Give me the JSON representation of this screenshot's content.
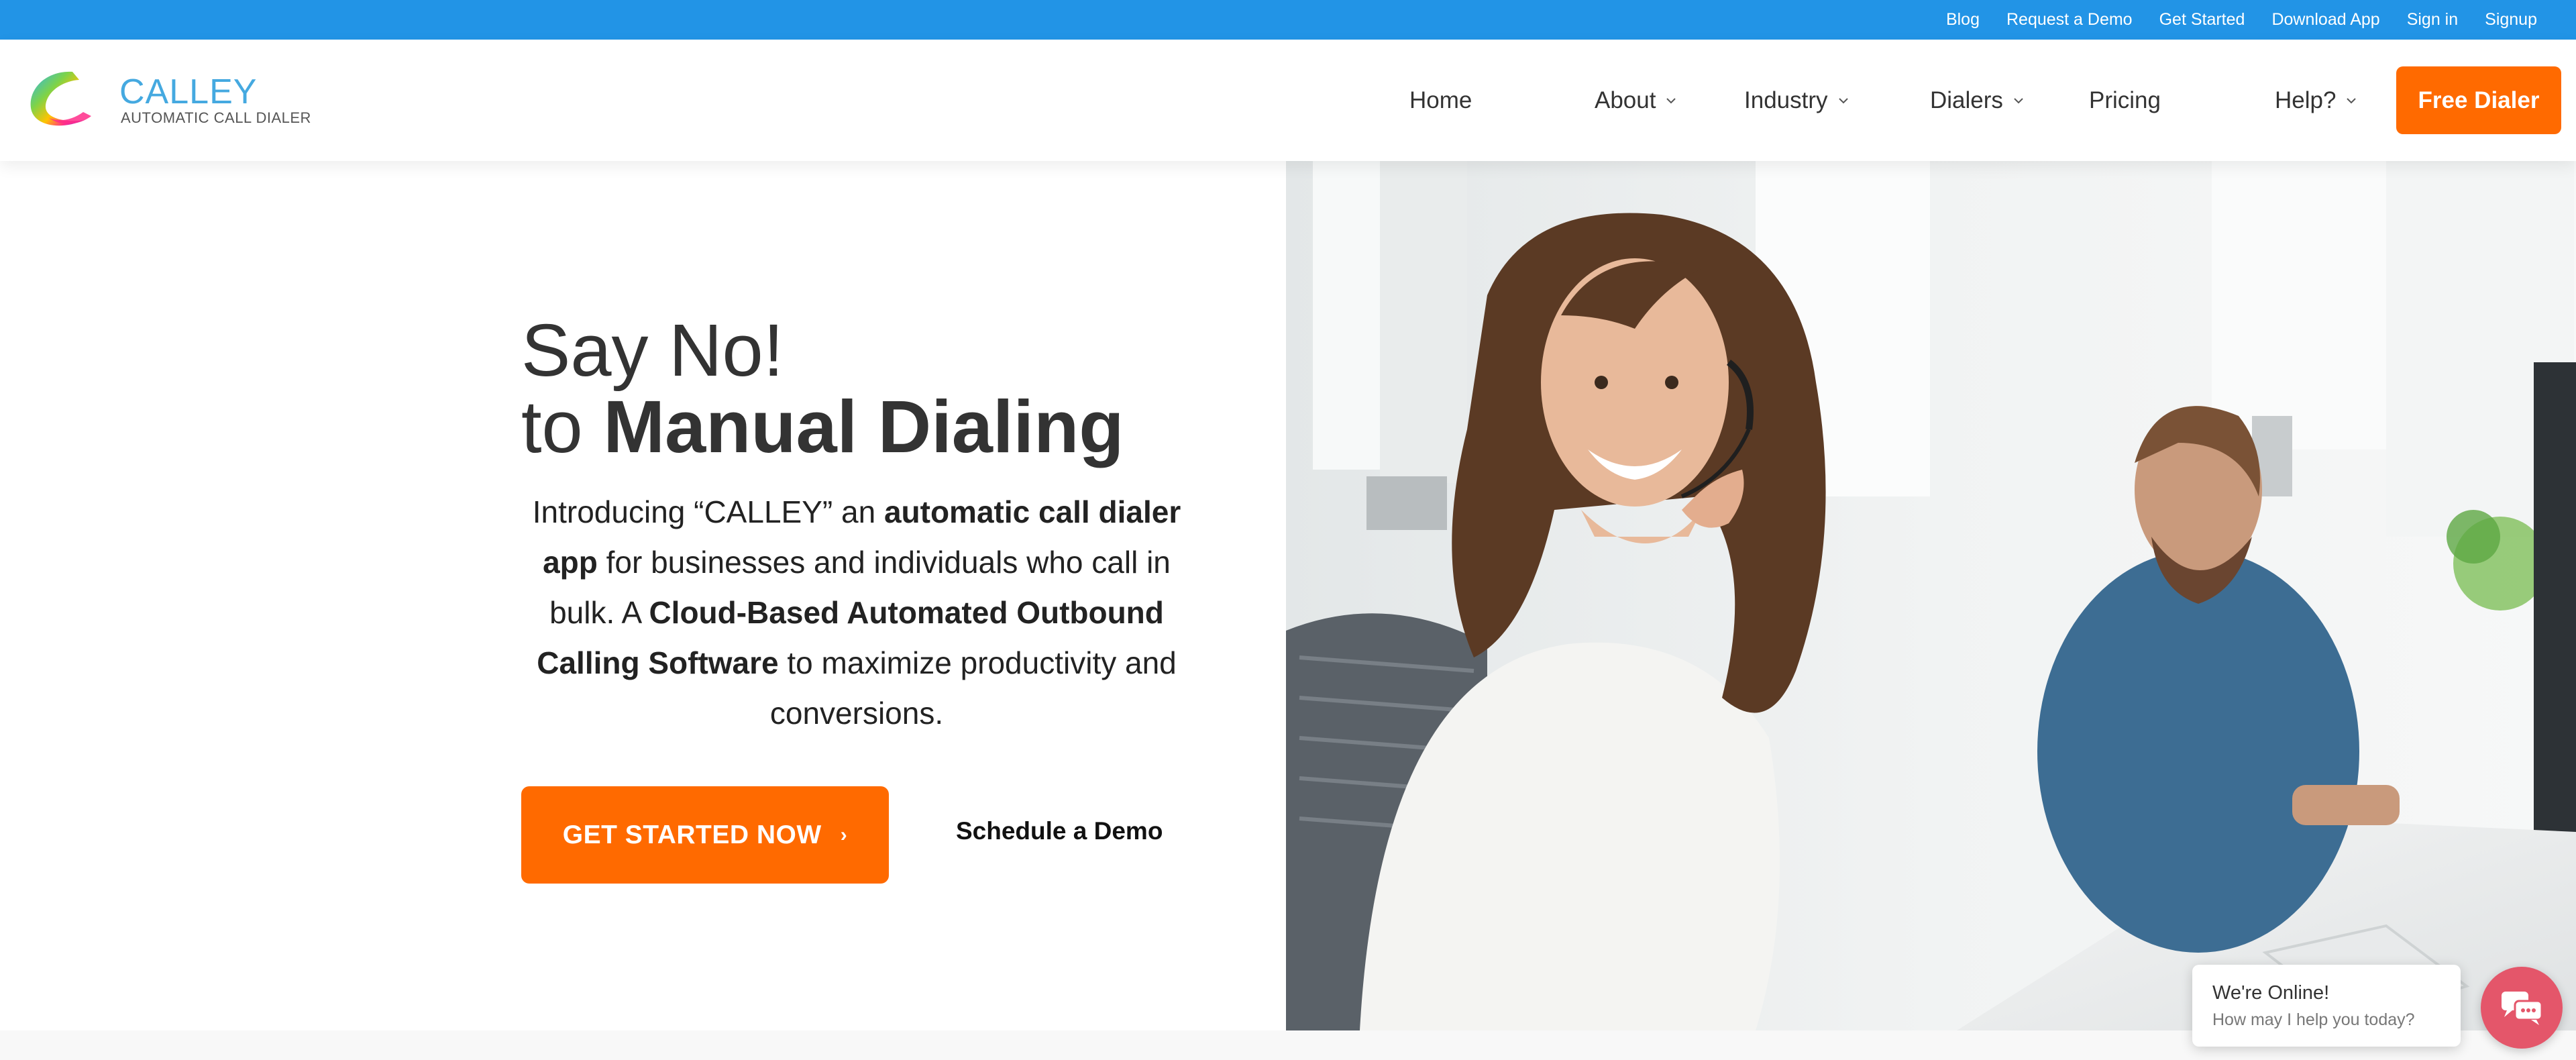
{
  "colors": {
    "topbar": "#2294e6",
    "accent": "#ff6a00",
    "logo_text": "#45a9e0",
    "chat": "#e4566a"
  },
  "topbar": {
    "links": [
      "Blog",
      "Request a Demo",
      "Get Started",
      "Download App",
      "Sign in",
      "Signup"
    ]
  },
  "logo": {
    "name": "CALLEY",
    "tagline": "AUTOMATIC CALL DIALER",
    "icon": "calley-swoosh-logo"
  },
  "nav": {
    "items": [
      {
        "label": "Home",
        "has_dropdown": false
      },
      {
        "label": "About",
        "has_dropdown": true
      },
      {
        "label": "Industry",
        "has_dropdown": true
      },
      {
        "label": "Dialers",
        "has_dropdown": true
      },
      {
        "label": "Pricing",
        "has_dropdown": false
      },
      {
        "label": "Help?",
        "has_dropdown": true
      }
    ],
    "cta_label": "Free Dialer"
  },
  "hero": {
    "line1": "Say No!",
    "line2_prefix": "to",
    "line2_bold": "Manual Dialing",
    "desc": {
      "p1": "Introducing “CALLEY” an",
      "b1": "automatic call dialer app",
      "p2": "for businesses and individuals who call in bulk. A",
      "b2": "Cloud-Based Automated Outbound Calling Software",
      "p3": "to maximize productivity and conversions."
    },
    "cta_label": "GET STARTED NOW",
    "cta_arrow": "›",
    "demo_label": "Schedule a Demo",
    "image_icon": "call-center-agents-photo"
  },
  "chat": {
    "title": "We're Online!",
    "subtitle": "How may I help you today?",
    "icon": "chat-icon"
  }
}
